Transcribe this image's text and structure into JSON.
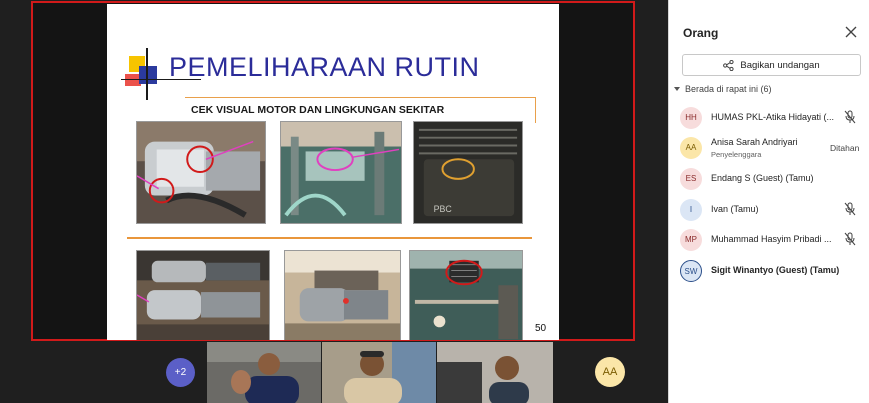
{
  "slide": {
    "title": "PEMELIHARAAN RUTIN",
    "subtitle": "CEK VISUAL MOTOR DAN LINGKUNGAN SEKITAR",
    "page_number": "50",
    "photo_label_brand": "PBC"
  },
  "tiles": {
    "more_count": "+2",
    "self_initials": "AA"
  },
  "panel": {
    "title": "Orang",
    "invite_label": "Bagikan undangan",
    "section_label": "Berada di rapat ini (6)",
    "participants": [
      {
        "initials": "HH",
        "name": "HUMAS PKL-Atika Hidayati (...",
        "role": "",
        "status": "",
        "muted": true,
        "avatar_bg": "#f7dcdc",
        "avatar_fg": "#8a2b2b"
      },
      {
        "initials": "AA",
        "name": "Anisa Sarah Andriyari",
        "role": "Penyelenggara",
        "status": "Ditahan",
        "muted": false,
        "avatar_bg": "#fbe6a8",
        "avatar_fg": "#7a5b00"
      },
      {
        "initials": "ES",
        "name": "Endang S (Guest) (Tamu)",
        "role": "",
        "status": "",
        "muted": false,
        "avatar_bg": "#f7dcdc",
        "avatar_fg": "#8a2b2b"
      },
      {
        "initials": "I",
        "name": "Ivan (Tamu)",
        "role": "",
        "status": "",
        "muted": true,
        "avatar_bg": "#dbe6f5",
        "avatar_fg": "#2b4f8a"
      },
      {
        "initials": "MP",
        "name": "Muhammad Hasyim Pribadi ...",
        "role": "",
        "status": "",
        "muted": true,
        "avatar_bg": "#f7dcdc",
        "avatar_fg": "#8a2b2b"
      },
      {
        "initials": "SW",
        "name": "Sigit Winantyo (Guest) (Tamu)",
        "role": "",
        "status": "",
        "muted": false,
        "avatar_bg": "#dbe6f5",
        "avatar_fg": "#2b4f8a"
      }
    ]
  },
  "colors": {
    "accent": "#5b5fc7",
    "share_border": "#d11a1a",
    "slide_title": "#2b2c99"
  }
}
